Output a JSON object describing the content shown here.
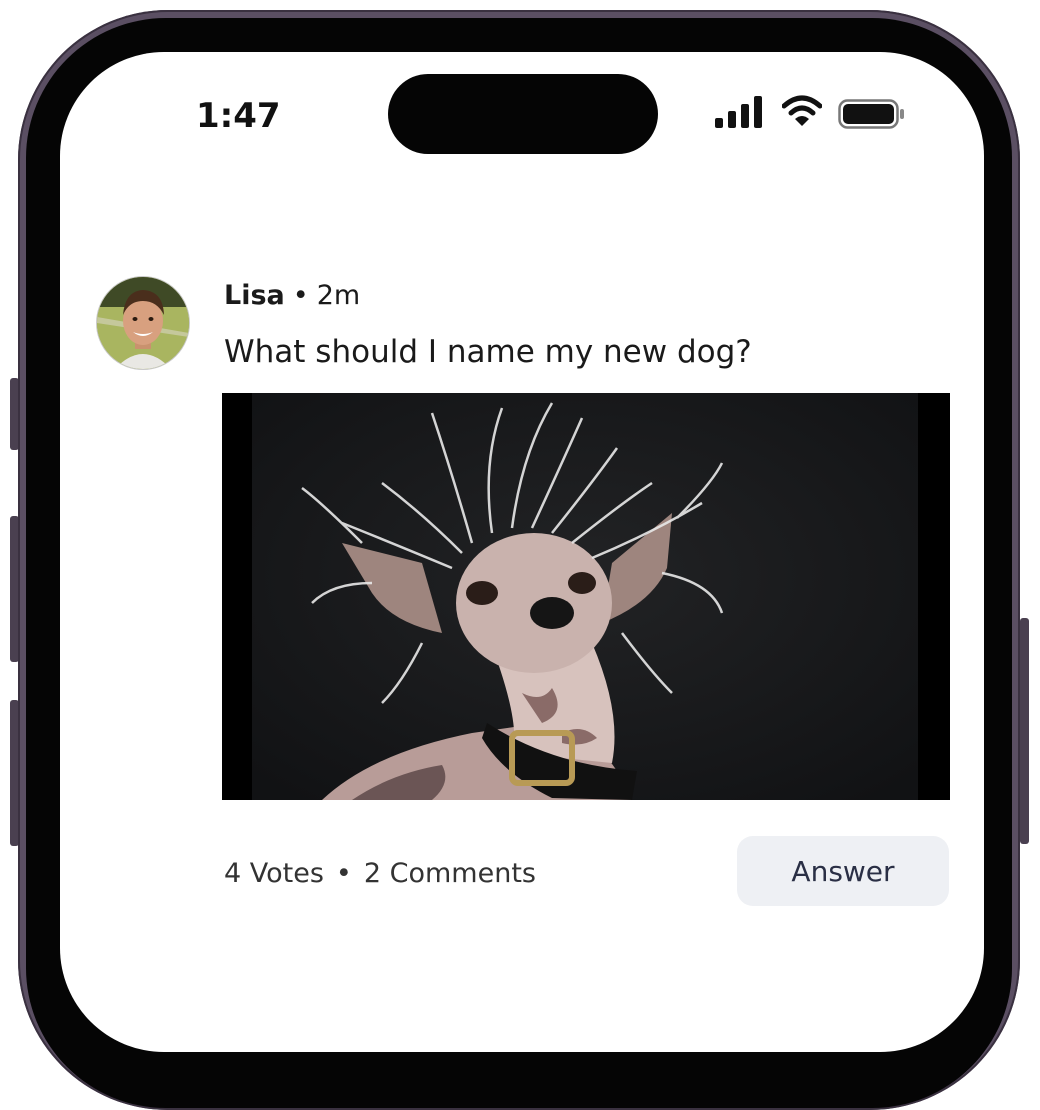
{
  "status_bar": {
    "time": "1:47",
    "icons": [
      "signal-icon",
      "wifi-icon",
      "battery-icon"
    ]
  },
  "post": {
    "author": "Lisa",
    "separator": "•",
    "time_ago": "2m",
    "question": "What should I name my new dog?",
    "image": "dog-photo",
    "votes": "4 Votes",
    "stats_separator": "•",
    "comments": "2 Comments",
    "answer_label": "Answer"
  },
  "colors": {
    "frame": "#5b4f63",
    "bezel": "#050505",
    "button_bg": "#eef0f4",
    "text": "#1a1a1a"
  }
}
